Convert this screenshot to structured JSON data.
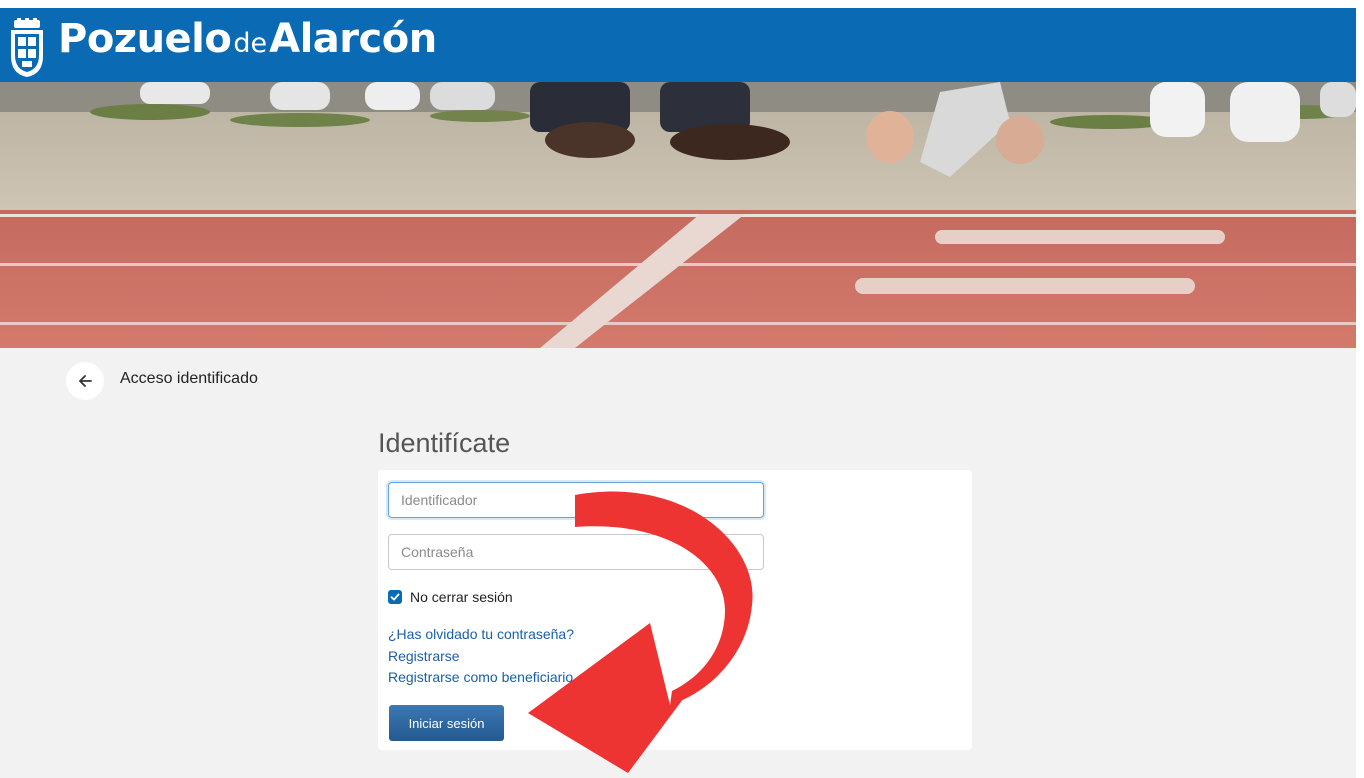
{
  "header": {
    "brand_part1": "Pozuelo",
    "brand_part2": "de",
    "brand_part3": "Alarcón",
    "background_color": "#0a6ab4",
    "logo_icon": "coat-of-arms-icon"
  },
  "breadcrumb": {
    "back_icon": "arrow-left-icon",
    "label": "Acceso identificado"
  },
  "login": {
    "title": "Identifícate",
    "identifier_placeholder": "Identificador",
    "identifier_value": "",
    "password_placeholder": "Contraseña",
    "password_value": "",
    "remember_label": "No cerrar sesión",
    "remember_checked": true,
    "forgot_link": "¿Has olvidado tu contraseña?",
    "register_link": "Registrarse",
    "register_beneficiary_link": "Registrarse como beneficiario",
    "submit_label": "Iniciar sesión"
  },
  "colors": {
    "accent": "#0a6ab4",
    "link": "#1a5fa8",
    "button": "#2d6aa3",
    "annotation_arrow": "#ee3333"
  }
}
